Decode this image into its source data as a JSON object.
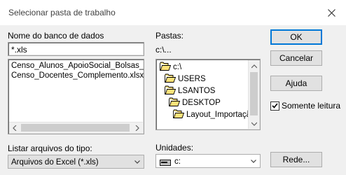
{
  "window": {
    "title": "Selecionar pasta de trabalho"
  },
  "database": {
    "label": "Nome do banco de dados",
    "input_value": "*.xls",
    "files": [
      "Censo_Alunos_ApoioSocial_Bolsas_",
      "Censo_Docentes_Complemento.xlsx"
    ]
  },
  "folders": {
    "label": "Pastas:",
    "current_path": "c:\\...",
    "tree": [
      {
        "name": "c:\\",
        "icon": "open-folder-icon"
      },
      {
        "name": "USERS",
        "icon": "open-folder-icon"
      },
      {
        "name": "LSANTOS",
        "icon": "open-folder-icon"
      },
      {
        "name": "DESKTOP",
        "icon": "open-folder-icon"
      },
      {
        "name": "Layout_Importação",
        "icon": "open-folder-icon"
      }
    ]
  },
  "buttons": {
    "ok": "OK",
    "cancel": "Cancelar",
    "help": "Ajuda",
    "network": "Rede..."
  },
  "readonly": {
    "label": "Somente leitura",
    "checked": true
  },
  "file_type": {
    "label": "Listar arquivos do tipo:",
    "selected": "Arquivos do Excel (*.xls)"
  },
  "drives": {
    "label": "Unidades:",
    "selected": "c:"
  }
}
